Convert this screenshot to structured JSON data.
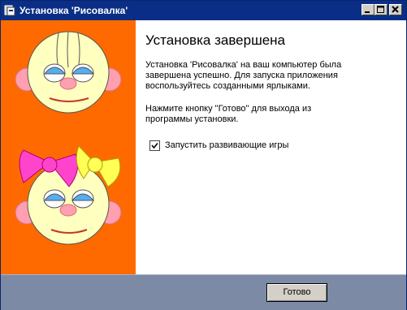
{
  "window": {
    "title": "Установка 'Рисовалка'",
    "icon": "installer-app-icon",
    "controls": [
      "minimize-icon",
      "maximize-icon",
      "close-icon"
    ]
  },
  "content": {
    "heading": "Установка завершена",
    "paragraph1": "Установка 'Рисовалка' на ваш компьютер была завершена успешно. Для запуска приложения воспользуйтесь созданными ярлыками.",
    "paragraph2": "Нажмите кнопку \"Готово\" для выхода из программы установки.",
    "checkbox": {
      "label": "Запустить развивающие игры",
      "checked": true
    }
  },
  "footer": {
    "done_label": "Готово"
  },
  "colors": {
    "title_bar": "#0a2e86",
    "side_panel": "#ff6a00",
    "footer": "#7c8aa6"
  }
}
